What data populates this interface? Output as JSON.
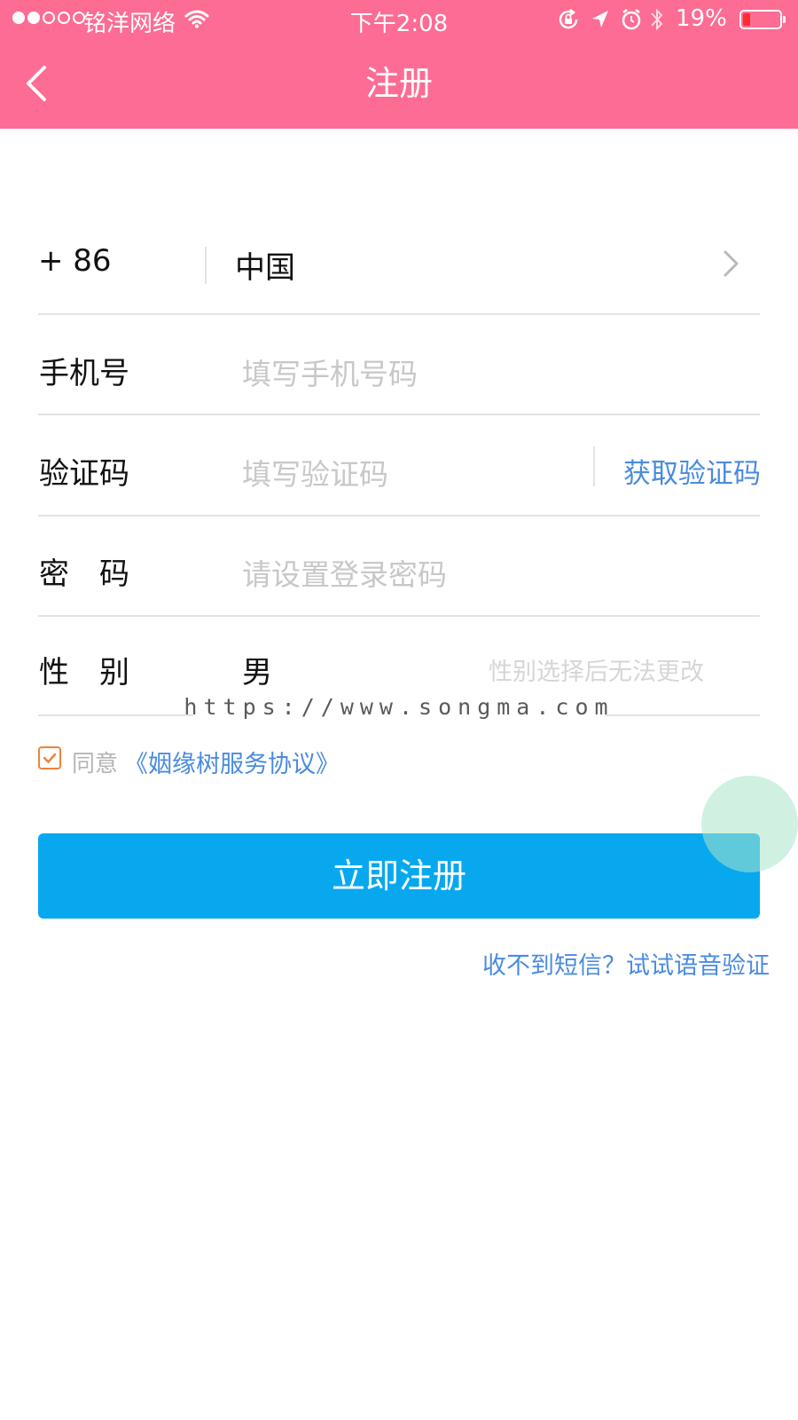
{
  "status_bar": {
    "carrier": "铭洋网络",
    "time": "下午2:08",
    "battery": "19%",
    "battery_level": 0.19,
    "icons": [
      "signal-dots-icon",
      "wifi-icon",
      "rotation-lock-icon",
      "location-arrow-icon",
      "alarm-clock-icon",
      "bluetooth-icon",
      "battery-icon"
    ]
  },
  "nav": {
    "title": "注册",
    "back_icon": "chevron-left-icon"
  },
  "form": {
    "country_code": "+ 86",
    "country": "中国",
    "country_chevron_icon": "chevron-right-icon",
    "phone_label": "手机号",
    "phone_placeholder": "填写手机号码",
    "code_label": "验证码",
    "code_placeholder": "填写验证码",
    "get_code": "获取验证码",
    "password_label": "密　码",
    "password_placeholder": "请设置登录密码",
    "gender_label": "性　别",
    "gender_value": "男",
    "gender_hint": "性别选择后无法更改"
  },
  "agreement": {
    "checked": true,
    "prefix": "同意",
    "link": "《姻缘树服务协议》"
  },
  "submit_label": "立即注册",
  "voice_verify": "收不到短信？试试语音验证",
  "watermark": "https://www.songma.com",
  "colors": {
    "header": "#fd6c93",
    "primary_button": "#08a8ef",
    "link": "#4a8be0",
    "placeholder": "#c8c8c8",
    "checkbox": "#f0813c"
  }
}
